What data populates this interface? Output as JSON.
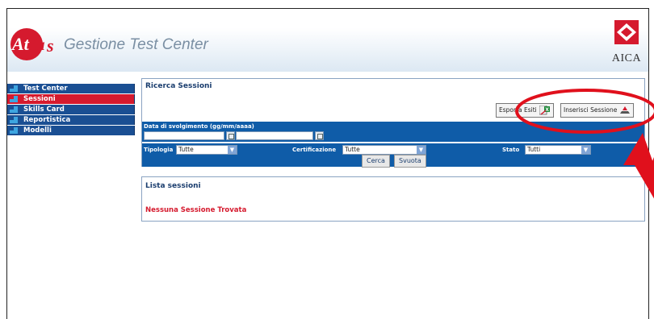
{
  "header": {
    "logo_text": "Atlas",
    "app_title": "Gestione Test Center",
    "aica_label": "AICA"
  },
  "sidebar": {
    "items": [
      {
        "label": "Test Center",
        "active": false
      },
      {
        "label": "Sessioni",
        "active": true
      },
      {
        "label": "Skills Card",
        "active": false
      },
      {
        "label": "Reportistica",
        "active": false
      },
      {
        "label": "Modelli",
        "active": false
      }
    ]
  },
  "search": {
    "title": "Ricerca Sessioni",
    "export_label": "Esporta Esiti",
    "insert_label": "Inserisci Sessione",
    "date_label": "Data di svolgimento (gg/mm/aaaa)",
    "date_from": "",
    "date_to": "",
    "tipologia_label": "Tipologia",
    "tipologia_value": "Tutte",
    "certificazione_label": "Certificazione",
    "certificazione_value": "Tutte",
    "stato_label": "Stato",
    "stato_value": "Tutti",
    "search_button": "Cerca",
    "clear_button": "Svuota"
  },
  "results": {
    "title": "Lista sessioni",
    "empty_message": "Nessuna Sessione Trovata"
  },
  "colors": {
    "nav_blue": "#1a4f93",
    "active_red": "#d51a2e",
    "band_blue": "#0f5ca8",
    "annotation_red": "#e0101c"
  }
}
